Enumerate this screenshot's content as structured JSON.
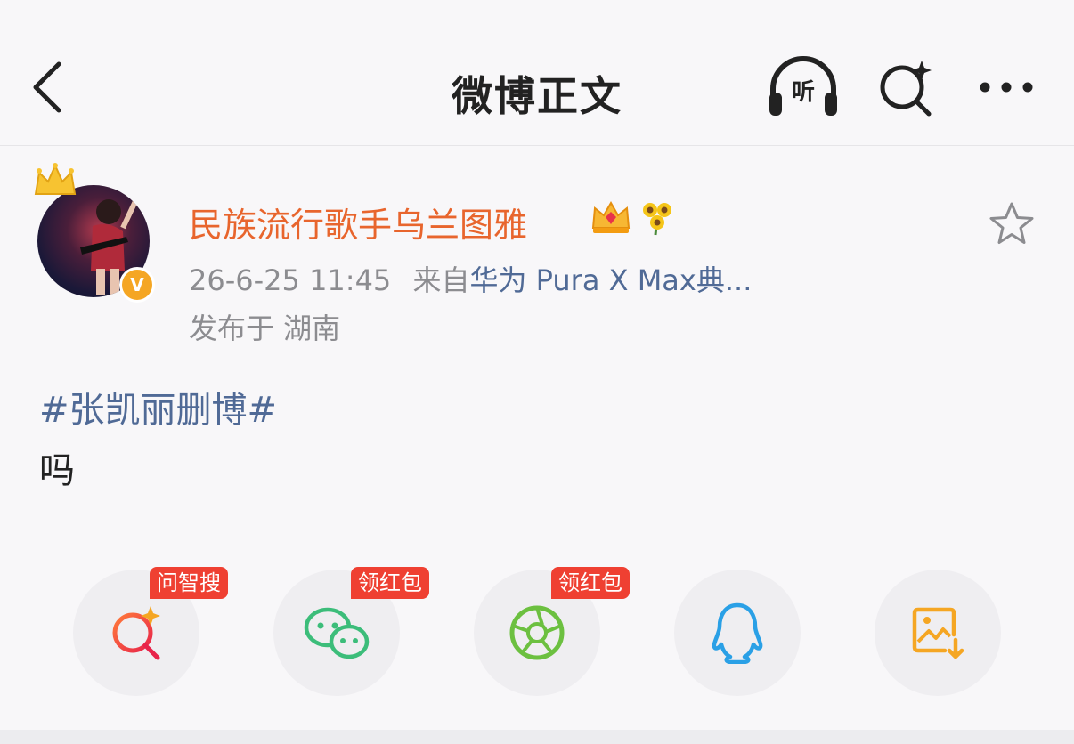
{
  "header": {
    "title": "微博正文",
    "listen_label": "听"
  },
  "post": {
    "username": "民族流行歌手乌兰图雅",
    "timestamp": "26-6-25 11:45",
    "source_prefix": "来自",
    "device": "华为 Pura X Max典...",
    "location": "发布于 湖南",
    "hashtag": "#张凯丽删博#",
    "text": "吗"
  },
  "share": {
    "items": [
      {
        "name": "ai-search",
        "tag": "问智搜",
        "icon": "search-sparkle-icon"
      },
      {
        "name": "wechat",
        "tag": "领红包",
        "icon": "wechat-icon"
      },
      {
        "name": "moments",
        "tag": "领红包",
        "icon": "moments-icon"
      },
      {
        "name": "qq",
        "tag": "",
        "icon": "qq-icon"
      },
      {
        "name": "save-image",
        "tag": "",
        "icon": "save-image-icon"
      }
    ]
  },
  "colors": {
    "username": "#e8652d",
    "link": "#506a96",
    "tag_bg": "#ef4032",
    "verified": "#f5a623"
  }
}
